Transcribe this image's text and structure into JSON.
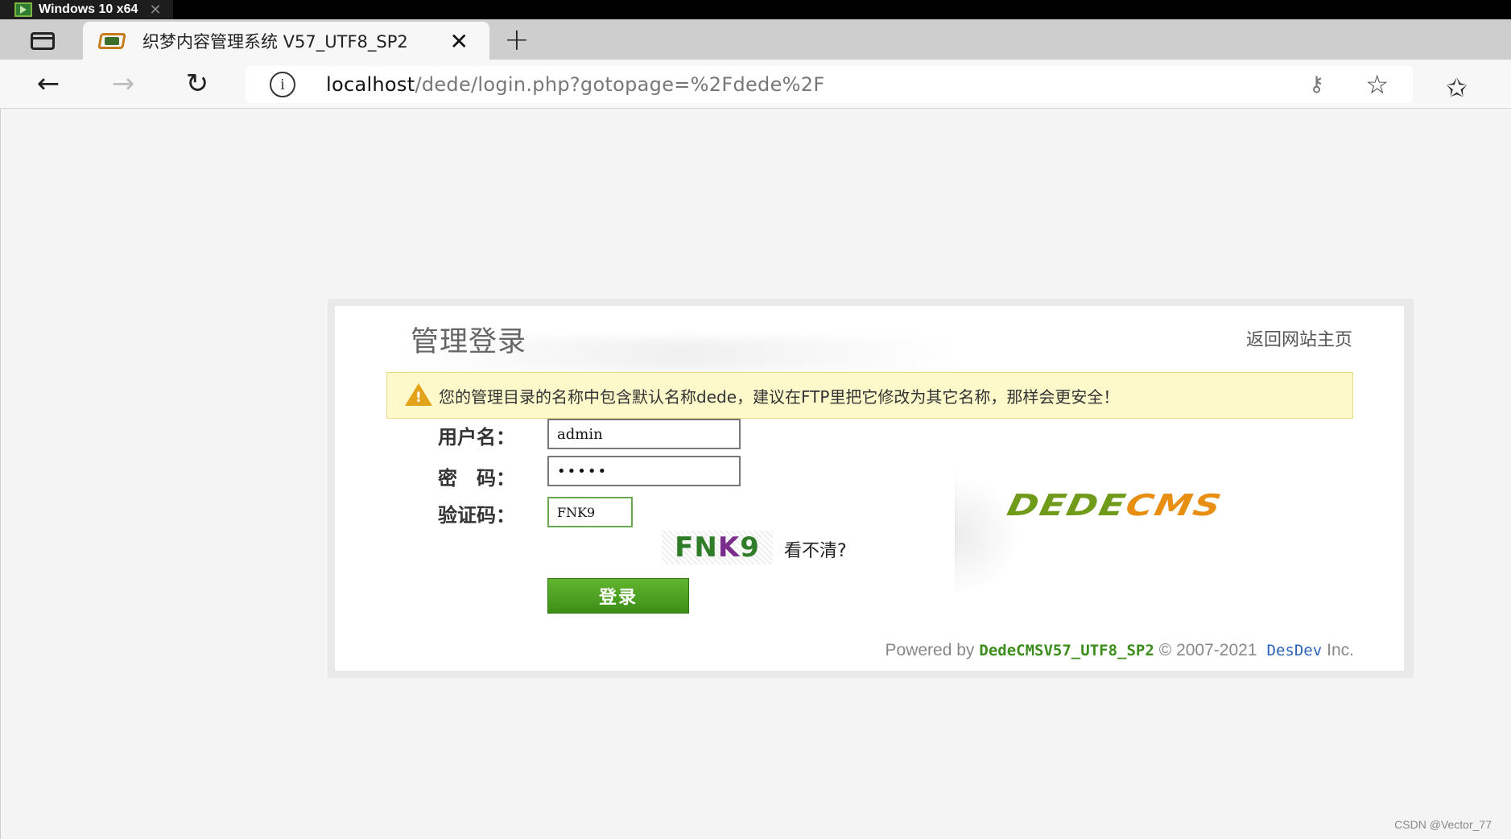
{
  "vm": {
    "title": "Windows 10 x64",
    "close": "✕"
  },
  "browser": {
    "tab_title": "织梦内容管理系统 V57_UTF8_SP2",
    "tab_close": "✕",
    "new_tab": "+",
    "url_host": "localhost",
    "url_path": "/dede/login.php?gotopage=%2Fdede%2F",
    "icons": [
      "tab-actions-icon",
      "back-arrow-icon",
      "forward-arrow-icon",
      "refresh-icon",
      "info-icon",
      "key-icon",
      "add-favorite-icon",
      "favorites-icon"
    ]
  },
  "login": {
    "title": "管理登录",
    "back_home": "返回网站主页",
    "alert": "您的管理目录的名称中包含默认名称dede，建议在FTP里把它修改为其它名称，那样会更安全！",
    "username_label": "用户名：",
    "username_value": "admin",
    "password_label": "密　码：",
    "password_value": "•••••",
    "captcha_label": "验证码：",
    "captcha_value": "FNK9",
    "captcha_image_text_a": "FN",
    "captcha_image_text_b": "K",
    "captcha_image_text_c": "9",
    "captcha_refresh": "看不清?",
    "submit": "登录",
    "brand_a": "DEDE",
    "brand_b": "CMS",
    "footer_prefix": "Powered by",
    "footer_version": "DedeCMSV57_UTF8_SP2",
    "footer_copy": "© 2007-2021",
    "footer_dev": "DesDev",
    "footer_inc": "Inc."
  },
  "watermark": "CSDN @Vector_77",
  "colors": {
    "accent_green": "#4aa01f",
    "alert_bg": "#fdf9cb",
    "brand_orange": "#e88f12"
  }
}
